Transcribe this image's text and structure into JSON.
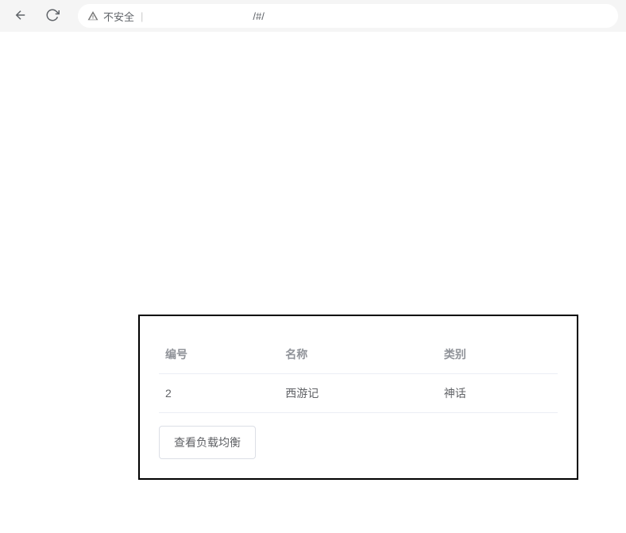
{
  "browser": {
    "security_label": "不安全",
    "url_path": "/#/"
  },
  "table": {
    "headers": {
      "id": "编号",
      "name": "名称",
      "category": "类别"
    },
    "row": {
      "id": "2",
      "name": "西游记",
      "category": "神话"
    }
  },
  "actions": {
    "view_load_balance": "查看负载均衡"
  }
}
